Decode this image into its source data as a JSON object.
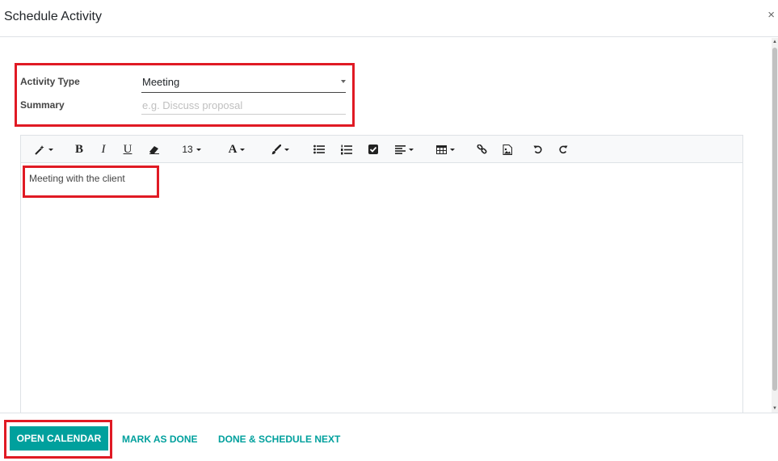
{
  "dialog": {
    "title": "Schedule Activity",
    "close_symbol": "×"
  },
  "form": {
    "activity_type_label": "Activity Type",
    "activity_type_value": "Meeting",
    "summary_label": "Summary",
    "summary_placeholder": "e.g. Discuss proposal",
    "summary_value": ""
  },
  "editor": {
    "toolbar": {
      "font_size": "13",
      "font_color_symbol": "A",
      "bold_symbol": "B",
      "italic_symbol": "I",
      "underline_symbol": "U",
      "icons": [
        "magic-wand-icon",
        "bold-icon",
        "italic-icon",
        "underline-icon",
        "eraser-icon",
        "font-size-dropdown",
        "font-color-icon",
        "brush-icon",
        "unordered-list-icon",
        "ordered-list-icon",
        "checklist-icon",
        "align-icon",
        "table-icon",
        "link-icon",
        "image-icon",
        "undo-icon",
        "redo-icon"
      ]
    },
    "body_text": "Meeting with the client"
  },
  "footer": {
    "open_calendar": "OPEN CALENDAR",
    "mark_as_done": "MARK AS DONE",
    "done_schedule_next": "DONE & SCHEDULE NEXT"
  },
  "colors": {
    "accent": "#00a09d",
    "highlight": "#e01a24"
  }
}
